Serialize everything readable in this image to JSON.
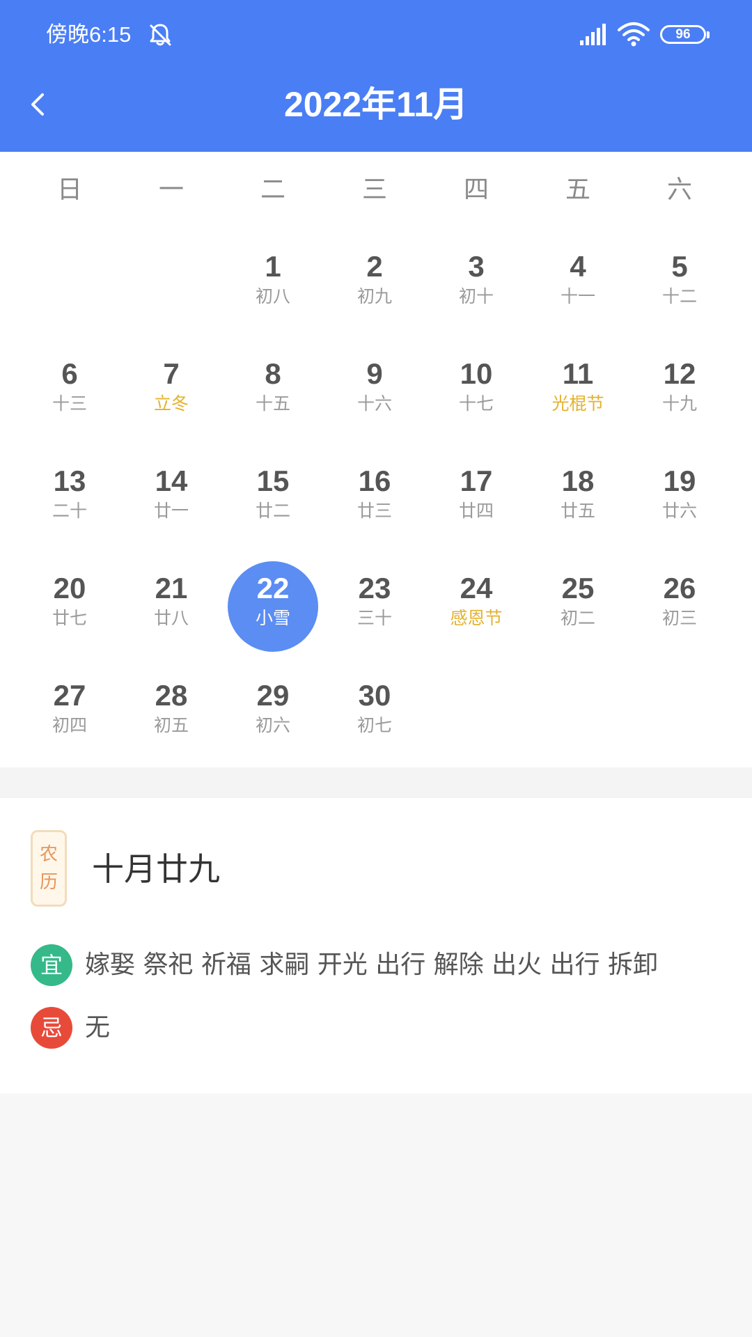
{
  "status_bar": {
    "time": "傍晚6:15",
    "battery": "96"
  },
  "header": {
    "title": "2022年11月"
  },
  "weekdays": [
    "日",
    "一",
    "二",
    "三",
    "四",
    "五",
    "六"
  ],
  "days": [
    {
      "day": "1",
      "lunar": "初八",
      "festival": false,
      "selected": false
    },
    {
      "day": "2",
      "lunar": "初九",
      "festival": false,
      "selected": false
    },
    {
      "day": "3",
      "lunar": "初十",
      "festival": false,
      "selected": false
    },
    {
      "day": "4",
      "lunar": "十一",
      "festival": false,
      "selected": false
    },
    {
      "day": "5",
      "lunar": "十二",
      "festival": false,
      "selected": false
    },
    {
      "day": "6",
      "lunar": "十三",
      "festival": false,
      "selected": false
    },
    {
      "day": "7",
      "lunar": "立冬",
      "festival": true,
      "selected": false
    },
    {
      "day": "8",
      "lunar": "十五",
      "festival": false,
      "selected": false
    },
    {
      "day": "9",
      "lunar": "十六",
      "festival": false,
      "selected": false
    },
    {
      "day": "10",
      "lunar": "十七",
      "festival": false,
      "selected": false
    },
    {
      "day": "11",
      "lunar": "光棍节",
      "festival": true,
      "selected": false
    },
    {
      "day": "12",
      "lunar": "十九",
      "festival": false,
      "selected": false
    },
    {
      "day": "13",
      "lunar": "二十",
      "festival": false,
      "selected": false
    },
    {
      "day": "14",
      "lunar": "廿一",
      "festival": false,
      "selected": false
    },
    {
      "day": "15",
      "lunar": "廿二",
      "festival": false,
      "selected": false
    },
    {
      "day": "16",
      "lunar": "廿三",
      "festival": false,
      "selected": false
    },
    {
      "day": "17",
      "lunar": "廿四",
      "festival": false,
      "selected": false
    },
    {
      "day": "18",
      "lunar": "廿五",
      "festival": false,
      "selected": false
    },
    {
      "day": "19",
      "lunar": "廿六",
      "festival": false,
      "selected": false
    },
    {
      "day": "20",
      "lunar": "廿七",
      "festival": false,
      "selected": false
    },
    {
      "day": "21",
      "lunar": "廿八",
      "festival": false,
      "selected": false
    },
    {
      "day": "22",
      "lunar": "小雪",
      "festival": false,
      "selected": true
    },
    {
      "day": "23",
      "lunar": "三十",
      "festival": false,
      "selected": false
    },
    {
      "day": "24",
      "lunar": "感恩节",
      "festival": true,
      "selected": false
    },
    {
      "day": "25",
      "lunar": "初二",
      "festival": false,
      "selected": false
    },
    {
      "day": "26",
      "lunar": "初三",
      "festival": false,
      "selected": false
    },
    {
      "day": "27",
      "lunar": "初四",
      "festival": false,
      "selected": false
    },
    {
      "day": "28",
      "lunar": "初五",
      "festival": false,
      "selected": false
    },
    {
      "day": "29",
      "lunar": "初六",
      "festival": false,
      "selected": false
    },
    {
      "day": "30",
      "lunar": "初七",
      "festival": false,
      "selected": false
    }
  ],
  "almanac": {
    "badge": [
      "农",
      "历"
    ],
    "lunar_date": "十月廿九",
    "yi_label": "宜",
    "yi_text": "嫁娶 祭祀 祈福 求嗣 开光 出行 解除 出火 出行 拆卸",
    "ji_label": "忌",
    "ji_text": "无"
  },
  "colors": {
    "primary": "#4a7ef5",
    "selected": "#5b8df2",
    "festival": "#e3b22d",
    "yi": "#35b989",
    "ji": "#e84a3a"
  }
}
